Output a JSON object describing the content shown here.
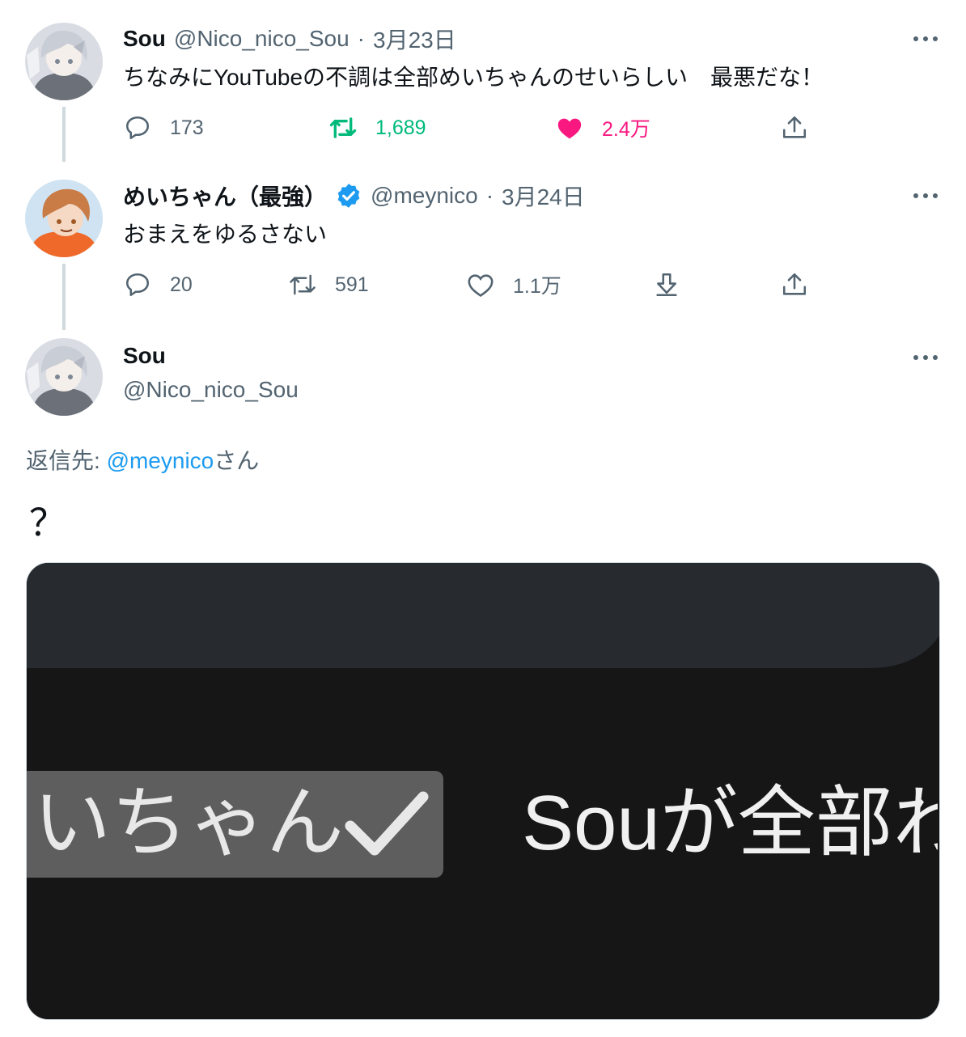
{
  "tweets": [
    {
      "name": "Sou",
      "handle": "@Nico_nico_Sou",
      "separator": "·",
      "date": "3月23日",
      "text": "ちなみにYouTubeの不調は全部めいちゃんのせいらしい　最悪だな！",
      "replies": "173",
      "retweets": "1,689",
      "likes": "2.4万"
    },
    {
      "name": "めいちゃん（最強）",
      "handle": "@meynico",
      "separator": "·",
      "date": "3月24日",
      "text": "おまえをゆるさない",
      "replies": "20",
      "retweets": "591",
      "likes": "1.1万"
    }
  ],
  "main_tweet": {
    "name": "Sou",
    "handle": "@Nico_nico_Sou",
    "reply_prefix": "返信先: ",
    "reply_to": "@meynico",
    "reply_suffix": "さん",
    "text": "？",
    "media": {
      "badge_text": "いちゃん",
      "caption_text": "Souが全部わ"
    }
  },
  "icons": [
    "more-icon",
    "reply-icon",
    "retweet-icon",
    "like-icon",
    "share-icon",
    "verified-icon",
    "download-icon"
  ],
  "colors": {
    "text": "#0f1419",
    "secondary": "#536471",
    "link": "#1d9bf0",
    "retweet_active": "#00ba7c",
    "like_active": "#f91880",
    "thread_line": "#cfd9de"
  }
}
